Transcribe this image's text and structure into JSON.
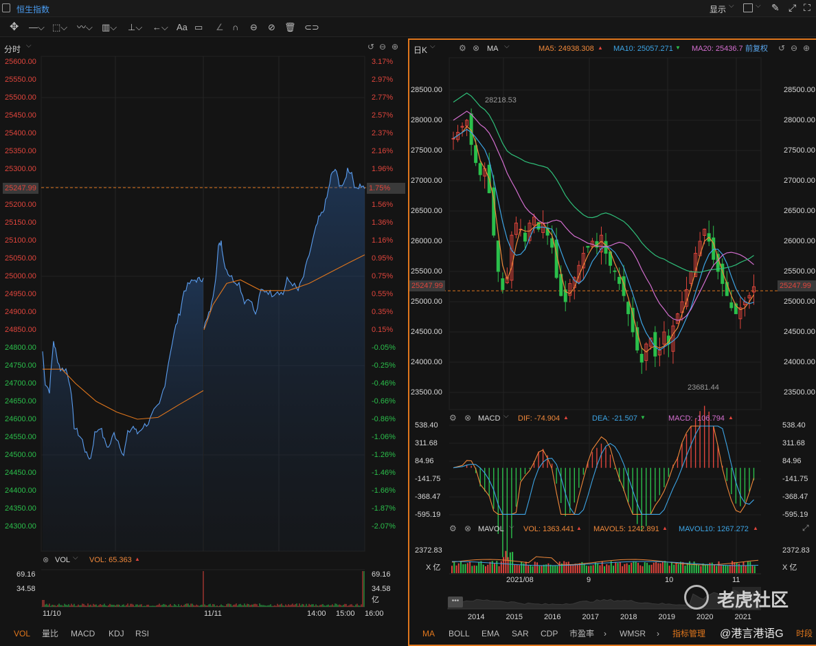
{
  "header": {
    "title": "恒生指数",
    "display_label": "显示"
  },
  "left": {
    "period": "分时",
    "price_ticks": [
      "25600.00",
      "25550.00",
      "25500.00",
      "25450.00",
      "25400.00",
      "25350.00",
      "25300.00",
      "25200.00",
      "25150.00",
      "25100.00",
      "25050.00",
      "25000.00",
      "24950.00",
      "24900.00",
      "24850.00",
      "24800.00",
      "24750.00",
      "24700.00",
      "24650.00",
      "24600.00",
      "24550.00",
      "24500.00",
      "24450.00",
      "24400.00",
      "24350.00",
      "24300.00"
    ],
    "pct_ticks_red": [
      "3.17%",
      "2.97%",
      "2.77%",
      "2.57%",
      "2.37%",
      "2.16%",
      "1.96%",
      "1.56%",
      "1.36%",
      "1.16%",
      "0.95%",
      "0.75%",
      "0.55%",
      "0.35%",
      "0.15%"
    ],
    "pct_ticks_green": [
      "-0.05%",
      "-0.25%",
      "-0.46%",
      "-0.66%",
      "-0.86%",
      "-1.06%",
      "-1.26%",
      "-1.46%",
      "-1.66%",
      "-1.87%",
      "-2.07%"
    ],
    "current_price": "25247.99",
    "current_pct": "1.75%",
    "vol_label": "VOL",
    "vol_value": "VOL: 65.363",
    "vol_ticks": [
      "69.16",
      "34.58"
    ],
    "vol_right_ticks": [
      "69.16",
      "34.58",
      "亿"
    ],
    "time_labels": [
      "11/10",
      "11/11",
      "14:00",
      "15:00",
      "16:00"
    ],
    "bottom_tabs": [
      "VOL",
      "量比",
      "MACD",
      "KDJ",
      "RSI"
    ]
  },
  "right": {
    "period": "日K",
    "indicator": "MA",
    "ma5": "MA5: 24938.308",
    "ma10": "MA10: 25057.271",
    "ma20": "MA20: 25436.7",
    "adjust": "前复权",
    "price_ticks": [
      "28500.00",
      "28000.00",
      "27500.00",
      "27000.00",
      "26500.00",
      "26000.00",
      "25500.00",
      "25000.00",
      "24500.00",
      "24000.00",
      "23500.00"
    ],
    "current_price": "25247.99",
    "high_label": "28218.53",
    "low_label": "23681.44",
    "macd": {
      "label": "MACD",
      "dif": "DIF: -74.904",
      "dea": "DEA: -21.507",
      "macd": "MACD: -106.794",
      "ticks": [
        "538.40",
        "311.68",
        "84.96",
        "-141.75",
        "-368.47",
        "-595.19"
      ]
    },
    "mavol": {
      "label": "MAVOL",
      "vol": "VOL: 1363.441",
      "mavol5": "MAVOL5: 1242.891",
      "mavol10": "MAVOL10: 1267.272",
      "ticks": [
        "2372.83",
        "X 亿"
      ]
    },
    "date_labels": [
      "2021/08",
      "9",
      "10",
      "11"
    ],
    "year_labels": [
      "2014",
      "2015",
      "2016",
      "2017",
      "2018",
      "2019",
      "2020",
      "2021"
    ],
    "bottom_tabs": [
      "MA",
      "BOLL",
      "EMA",
      "SAR",
      "CDP",
      "市盈率",
      "WMSR",
      "指标管理",
      "时段"
    ],
    "watermark": "老虎社区",
    "watermark_user": "@港言港语G"
  },
  "colors": {
    "up": "#e0453c",
    "down": "#2bbf4b",
    "accent": "#e0761c",
    "ma5": "#f0883a",
    "ma10": "#3da5e6",
    "ma20": "#d46fd0",
    "ma60": "#2fc07a"
  }
}
